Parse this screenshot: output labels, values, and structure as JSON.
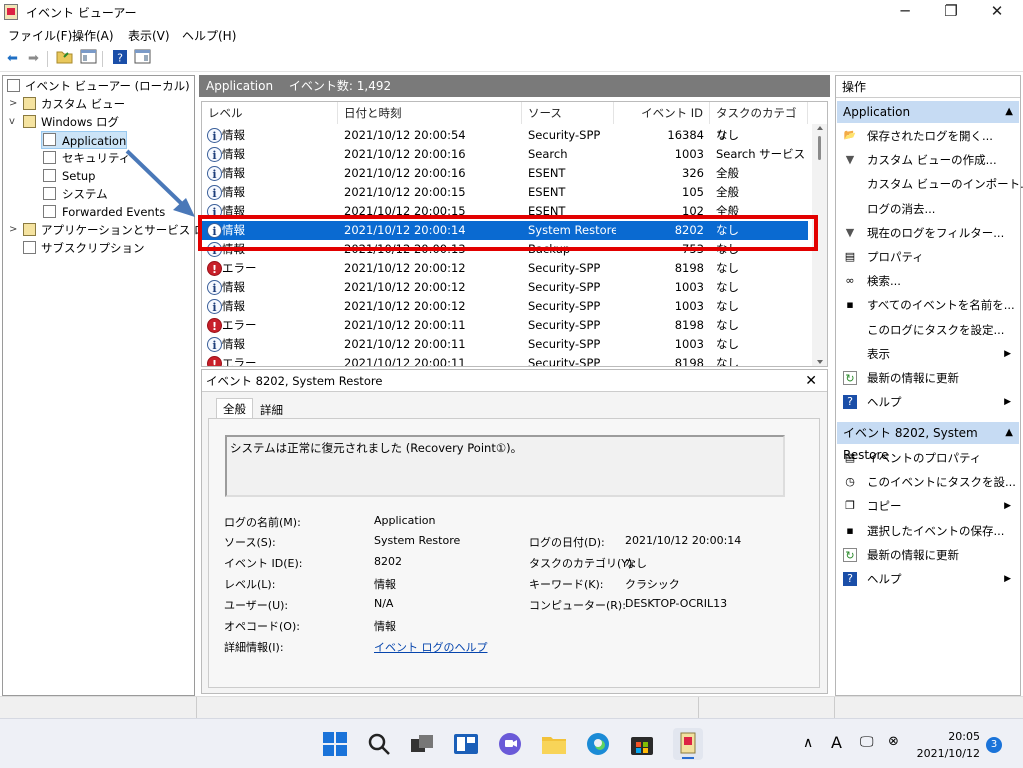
{
  "window": {
    "title": "イベント ビューアー",
    "minimize": "─",
    "maximize": "❐",
    "close": "✕"
  },
  "menu": [
    "ファイル(F)",
    "操作(A)",
    "表示(V)",
    "ヘルプ(H)"
  ],
  "tree": {
    "root": "イベント ビューアー (ローカル)",
    "custom": "カスタム ビュー",
    "windows_logs": "Windows ログ",
    "logs": [
      "Application",
      "セキュリティ",
      "Setup",
      "システム",
      "Forwarded Events"
    ],
    "apps": "アプリケーションとサービス ログ",
    "subs": "サブスクリプション"
  },
  "header": {
    "log": "Application",
    "count": "イベント数: 1,492"
  },
  "columns": [
    "レベル",
    "日付と時刻",
    "ソース",
    "イベント ID",
    "タスクのカテゴリ"
  ],
  "rows": [
    {
      "level": "情報",
      "type": "info",
      "date": "2021/10/12 20:00:54",
      "source": "Security-SPP",
      "id": "16384",
      "cat": "なし"
    },
    {
      "level": "情報",
      "type": "info",
      "date": "2021/10/12 20:00:16",
      "source": "Search",
      "id": "1003",
      "cat": "Search サービス"
    },
    {
      "level": "情報",
      "type": "info",
      "date": "2021/10/12 20:00:16",
      "source": "ESENT",
      "id": "326",
      "cat": "全般"
    },
    {
      "level": "情報",
      "type": "info",
      "date": "2021/10/12 20:00:15",
      "source": "ESENT",
      "id": "105",
      "cat": "全般"
    },
    {
      "level": "情報",
      "type": "info",
      "date": "2021/10/12 20:00:15",
      "source": "ESENT",
      "id": "102",
      "cat": "全般"
    },
    {
      "level": "情報",
      "type": "info",
      "date": "2021/10/12 20:00:14",
      "source": "System Restore",
      "id": "8202",
      "cat": "なし"
    },
    {
      "level": "情報",
      "type": "info",
      "date": "2021/10/12 20:00:13",
      "source": "Backup",
      "id": "753",
      "cat": "なし"
    },
    {
      "level": "エラー",
      "type": "err",
      "date": "2021/10/12 20:00:12",
      "source": "Security-SPP",
      "id": "8198",
      "cat": "なし"
    },
    {
      "level": "情報",
      "type": "info",
      "date": "2021/10/12 20:00:12",
      "source": "Security-SPP",
      "id": "1003",
      "cat": "なし"
    },
    {
      "level": "情報",
      "type": "info",
      "date": "2021/10/12 20:00:12",
      "source": "Security-SPP",
      "id": "1003",
      "cat": "なし"
    },
    {
      "level": "エラー",
      "type": "err",
      "date": "2021/10/12 20:00:11",
      "source": "Security-SPP",
      "id": "8198",
      "cat": "なし"
    },
    {
      "level": "情報",
      "type": "info",
      "date": "2021/10/12 20:00:11",
      "source": "Security-SPP",
      "id": "1003",
      "cat": "なし"
    },
    {
      "level": "エラー",
      "type": "err",
      "date": "2021/10/12 20:00:11",
      "source": "Security-SPP",
      "id": "8198",
      "cat": "なし"
    }
  ],
  "detail": {
    "title": "イベント 8202, System Restore",
    "tabs": [
      "全般",
      "詳細"
    ],
    "description": "システムは正常に復元されました (Recovery Point①)。",
    "log_name_label": "ログの名前(M):",
    "log_name": "Application",
    "source_label": "ソース(S):",
    "source": "System Restore",
    "logged_label": "ログの日付(D):",
    "logged": "2021/10/12 20:00:14",
    "event_id_label": "イベント ID(E):",
    "event_id": "8202",
    "task_label": "タスクのカテゴリ(Y):",
    "task": "なし",
    "level_label": "レベル(L):",
    "level": "情報",
    "keywords_label": "キーワード(K):",
    "keywords": "クラシック",
    "user_label": "ユーザー(U):",
    "user": "N/A",
    "computer_label": "コンピューター(R):",
    "computer": "DESKTOP-OCRIL13",
    "opcode_label": "オペコード(O):",
    "opcode": "情報",
    "more_label": "詳細情報(I):",
    "more": "イベント ログのヘルプ"
  },
  "actions": {
    "title": "操作",
    "section1": "Application",
    "items1": [
      {
        "label": "保存されたログを開く...",
        "icon": "folder-open-icon",
        "glyph": "📂",
        "sub": false
      },
      {
        "label": "カスタム ビューの作成...",
        "icon": "filter-icon",
        "glyph": "▼",
        "sub": false
      },
      {
        "label": "カスタム ビューのインポート...",
        "icon": "",
        "glyph": "",
        "sub": false
      },
      {
        "label": "ログの消去...",
        "icon": "",
        "glyph": "",
        "sub": false
      },
      {
        "label": "現在のログをフィルター...",
        "icon": "filter-icon",
        "glyph": "▼",
        "sub": false
      },
      {
        "label": "プロパティ",
        "icon": "properties-icon",
        "glyph": "▤",
        "sub": false
      },
      {
        "label": "検索...",
        "icon": "binoculars-icon",
        "glyph": "∞",
        "sub": false
      },
      {
        "label": "すべてのイベントを名前を...",
        "icon": "save-icon",
        "glyph": "▪",
        "sub": false
      },
      {
        "label": "このログにタスクを設定...",
        "icon": "",
        "glyph": "",
        "sub": false
      },
      {
        "label": "表示",
        "icon": "",
        "glyph": "",
        "sub": true
      },
      {
        "label": "最新の情報に更新",
        "icon": "refresh-icon",
        "glyph": "↻",
        "sub": false
      },
      {
        "label": "ヘルプ",
        "icon": "help-icon",
        "glyph": "?",
        "sub": true
      }
    ],
    "section2": "イベント 8202, System Restore",
    "items2": [
      {
        "label": "イベントのプロパティ",
        "icon": "properties-icon",
        "glyph": "▤",
        "sub": false
      },
      {
        "label": "このイベントにタスクを設...",
        "icon": "task-icon",
        "glyph": "◷",
        "sub": false
      },
      {
        "label": "コピー",
        "icon": "copy-icon",
        "glyph": "❐",
        "sub": true
      },
      {
        "label": "選択したイベントの保存...",
        "icon": "save-icon",
        "glyph": "▪",
        "sub": false
      },
      {
        "label": "最新の情報に更新",
        "icon": "refresh-icon",
        "glyph": "↻",
        "sub": false
      },
      {
        "label": "ヘルプ",
        "icon": "help-icon",
        "glyph": "?",
        "sub": true
      }
    ]
  },
  "taskbar": {
    "time": "20:05",
    "date": "2021/10/12",
    "badge": "3",
    "ime": "A"
  },
  "colors": {
    "selection": "#0a6ad1",
    "highlight_box": "#e20000",
    "arrow": "#4a78b8",
    "section": "#c6dbf3"
  }
}
